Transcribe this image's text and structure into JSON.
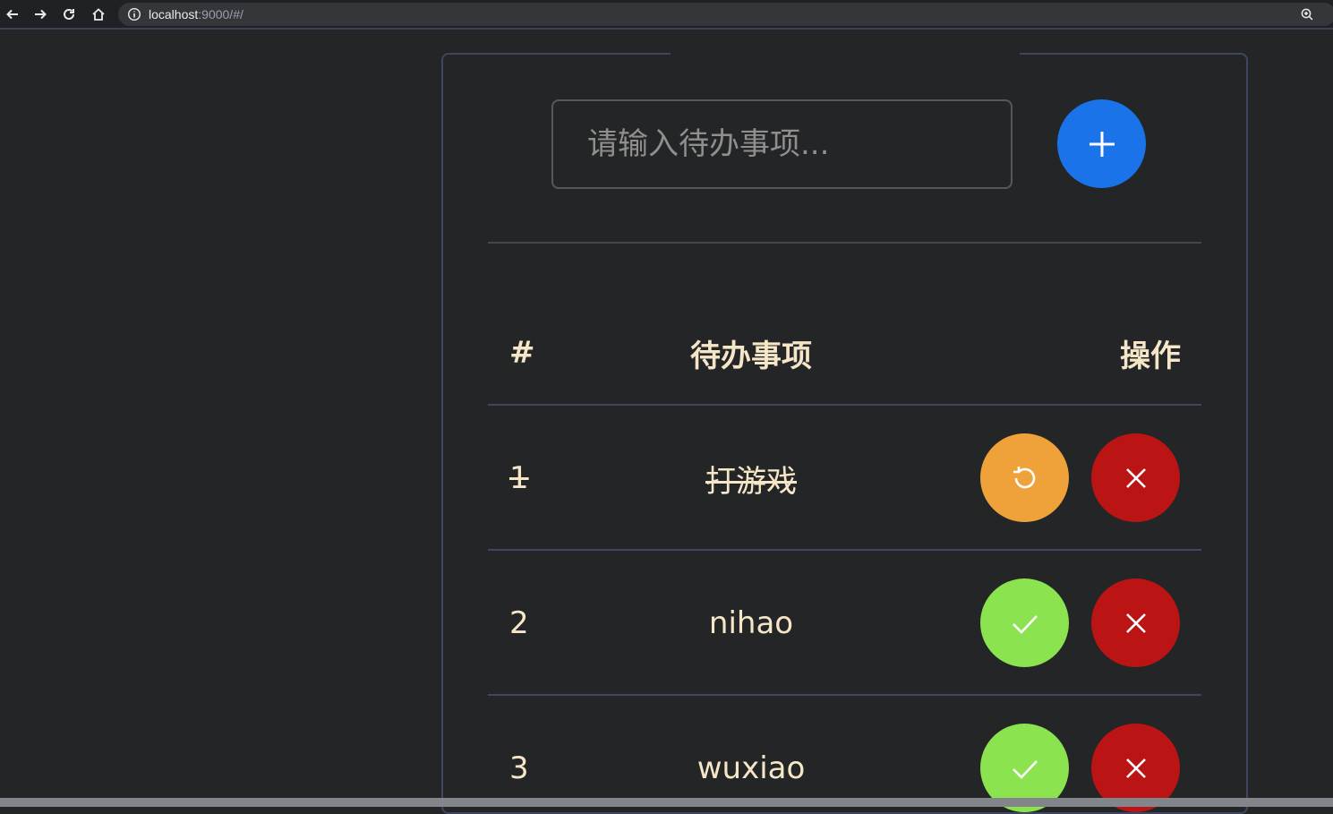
{
  "browser": {
    "url_host": "localhost",
    "url_rest": ":9000/#/"
  },
  "todo": {
    "input_placeholder": "请输入待办事项...",
    "input_value": ""
  },
  "table": {
    "headers": {
      "number": "#",
      "task": "待办事项",
      "actions": "操作"
    },
    "rows": [
      {
        "number": "1",
        "task": "打游戏",
        "done": true
      },
      {
        "number": "2",
        "task": "nihao",
        "done": false
      },
      {
        "number": "3",
        "task": "wuxiao",
        "done": false
      }
    ]
  },
  "icons": {
    "add": "plus-icon",
    "undo": "undo-icon",
    "complete": "check-icon",
    "delete": "close-icon"
  },
  "colors": {
    "background": "#242526",
    "text": "#f5e6c8",
    "add_button": "#1a73e8",
    "undo_button": "#f0a23a",
    "complete_button": "#8ae34f",
    "delete_button": "#bb1414"
  }
}
